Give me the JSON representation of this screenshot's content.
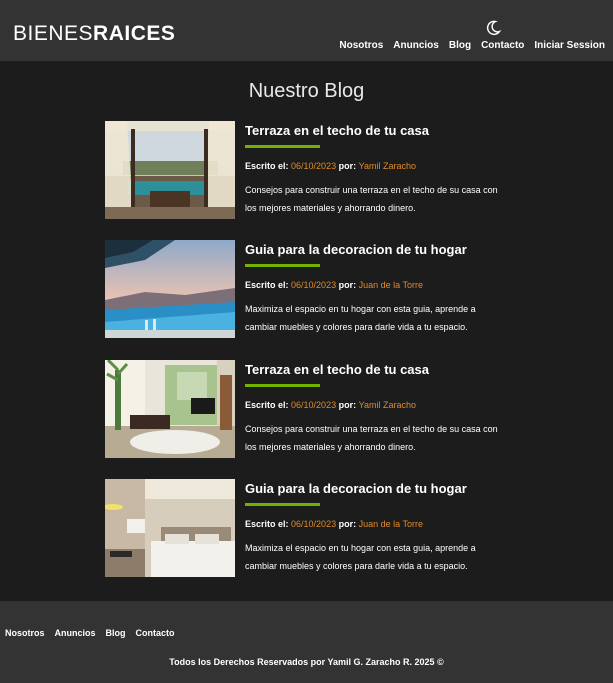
{
  "header": {
    "logo_light": "BIENES",
    "logo_bold": "RAICES",
    "theme_toggle_icon": "moon-icon",
    "nav": [
      "Nosotros",
      "Anuncios",
      "Blog",
      "Contacto",
      "Iniciar Session"
    ]
  },
  "main": {
    "title": "Nuestro Blog",
    "written_label": "Escrito el:",
    "by_label": "por:",
    "posts": [
      {
        "title": "Terraza en el techo de tu casa",
        "date": "06/10/2023",
        "author": "Yamil Zaracho",
        "excerpt": "Consejos para construir una terraza en el techo de su casa con los mejores materiales y ahorrando dinero.",
        "image": "rooftop-terrace-image"
      },
      {
        "title": "Guia para la decoracion de tu hogar",
        "date": "06/10/2023",
        "author": "Juan de la Torre",
        "excerpt": "Maximiza el espacio en tu hogar con esta guia, aprende a cambiar muebles y colores para darle vida a tu espacio.",
        "image": "infinity-pool-image"
      },
      {
        "title": "Terraza en el techo de tu casa",
        "date": "06/10/2023",
        "author": "Yamil Zaracho",
        "excerpt": "Consejos para construir una terraza en el techo de su casa con los mejores materiales y ahorrando dinero.",
        "image": "living-room-image"
      },
      {
        "title": "Guia para la decoracion de tu hogar",
        "date": "06/10/2023",
        "author": "Juan de la Torre",
        "excerpt": "Maximiza el espacio en tu hogar con esta guia, aprende a cambiar muebles y colores para darle vida a tu espacio.",
        "image": "bedroom-image"
      }
    ]
  },
  "footer": {
    "nav": [
      "Nosotros",
      "Anuncios",
      "Blog",
      "Contacto"
    ],
    "copyright": "Todos los Derechos Reservados por Yamil G. Zaracho R. 2025 ©"
  },
  "colors": {
    "accent_green": "#71b100",
    "accent_orange": "#e08a2c",
    "header_bg": "#333333",
    "body_bg": "#1c1c1c"
  }
}
